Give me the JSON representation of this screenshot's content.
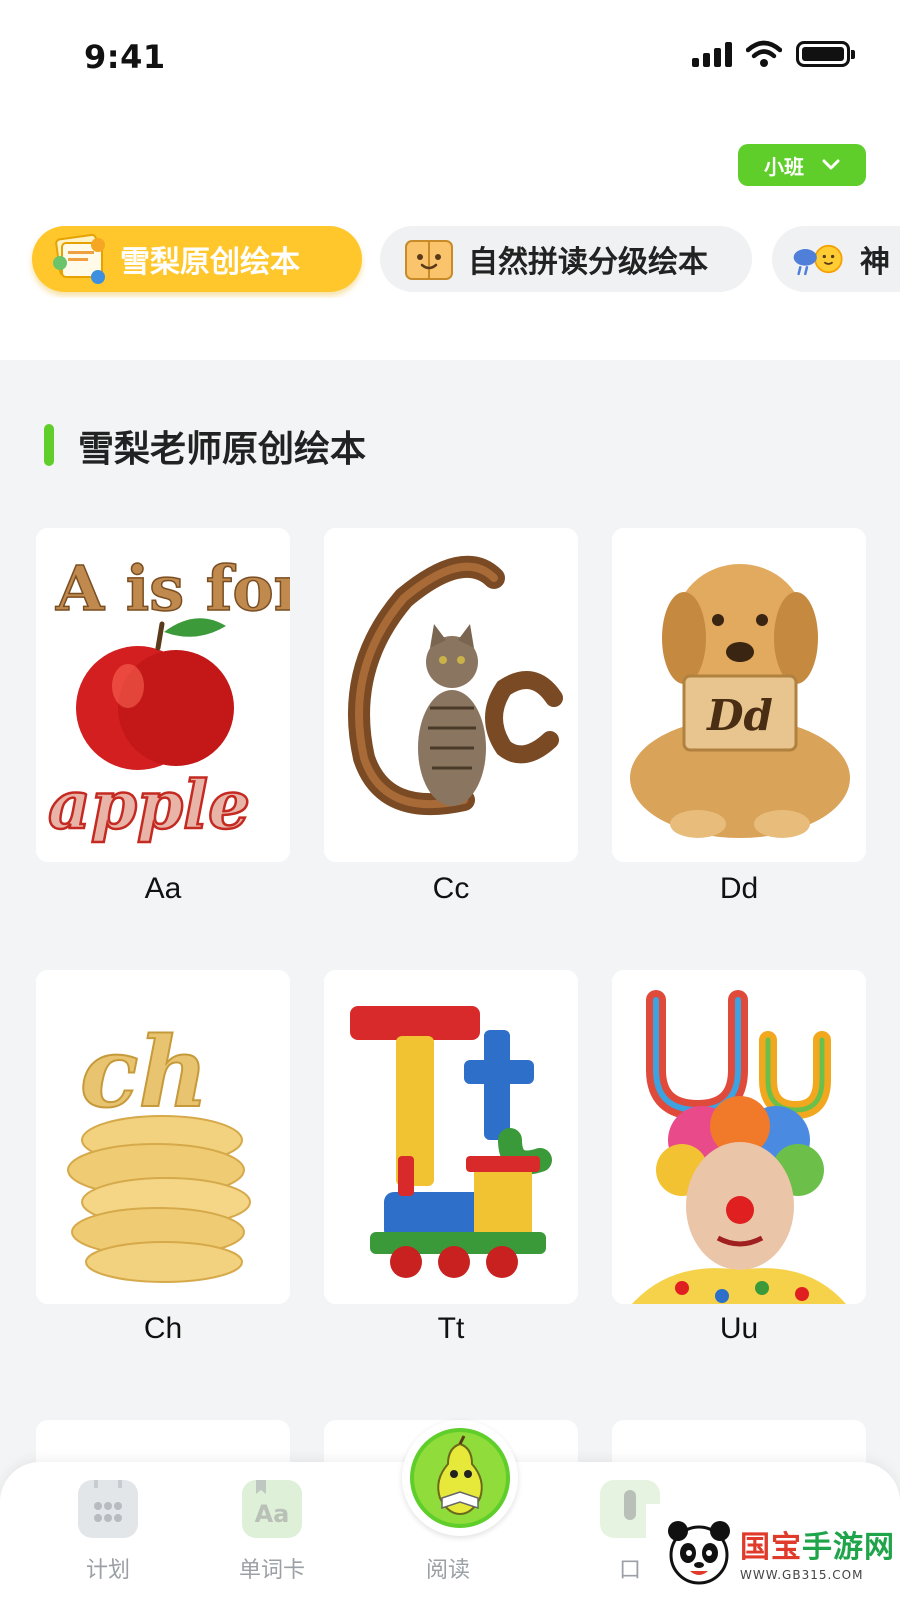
{
  "status_bar": {
    "time": "9:41"
  },
  "class_selector": {
    "label": "小班"
  },
  "category_tabs": [
    {
      "label": "雪梨原创绘本",
      "active": true
    },
    {
      "label": "自然拼读分级绘本",
      "active": false
    },
    {
      "label": "神",
      "active": false
    }
  ],
  "section": {
    "title": "雪梨老师原创绘本"
  },
  "books": [
    {
      "label": "Aa",
      "cover_text": [
        "A is for",
        "apple"
      ]
    },
    {
      "label": "Cc",
      "cover_text": [
        "Cc"
      ]
    },
    {
      "label": "Dd",
      "cover_text": [
        "Dd"
      ]
    },
    {
      "label": "Ch",
      "cover_text": [
        "ch"
      ]
    },
    {
      "label": "Tt",
      "cover_text": [
        "T",
        "t"
      ]
    },
    {
      "label": "Uu",
      "cover_text": [
        "Uu"
      ]
    }
  ],
  "tab_bar": {
    "items": [
      {
        "label": "计划",
        "icon": "calendar-icon"
      },
      {
        "label": "单词卡",
        "icon": "word-card-icon",
        "icon_text": "Aa"
      },
      {
        "label": "阅读",
        "icon": "pear-reading-icon"
      },
      {
        "label": "口",
        "icon": "microphone-icon"
      }
    ]
  },
  "watermark": {
    "title_red": "国宝",
    "title_green": "手游网",
    "url": "WWW.GB315.COM"
  },
  "colors": {
    "accent_green": "#5fce2a",
    "tab_yellow": "#ffc72c",
    "background": "#f2f4f5"
  }
}
